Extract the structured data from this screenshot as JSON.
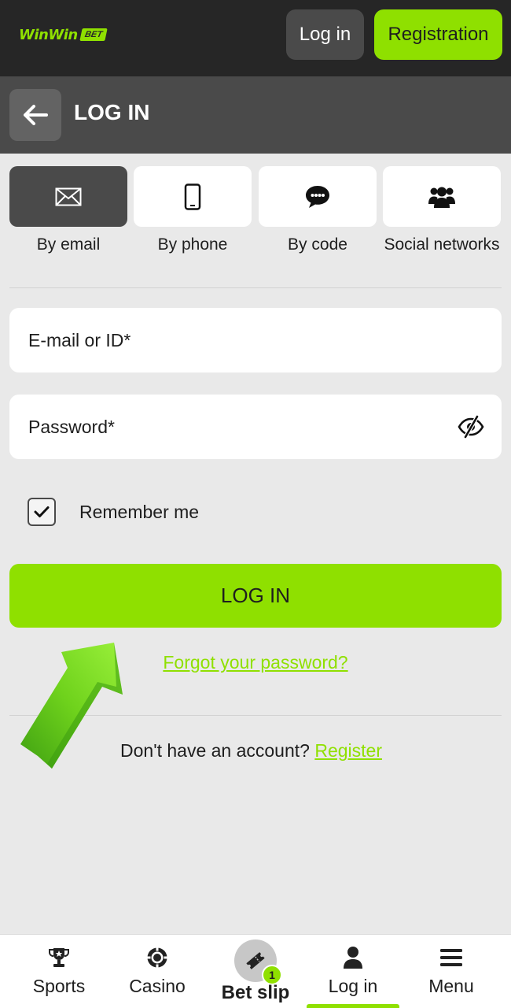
{
  "header": {
    "logo_text": "WinWin",
    "logo_badge": "BET",
    "login_label": "Log in",
    "registration_label": "Registration"
  },
  "title_bar": {
    "title": "LOG IN"
  },
  "login_methods": [
    {
      "label": "By email",
      "icon": "envelope-icon",
      "active": true
    },
    {
      "label": "By phone",
      "icon": "phone-icon",
      "active": false
    },
    {
      "label": "By code",
      "icon": "chat-bubble-icon",
      "active": false
    },
    {
      "label": "Social networks",
      "icon": "people-icon",
      "active": false
    }
  ],
  "form": {
    "email_placeholder": "E-mail or ID*",
    "email_value": "",
    "password_placeholder": "Password*",
    "password_value": "",
    "remember_label": "Remember me",
    "remember_checked": true,
    "submit_label": "LOG IN",
    "forgot_label": "Forgot your password?"
  },
  "register_prompt": {
    "text": "Don't have an account?",
    "link": "Register"
  },
  "bottom_nav": {
    "items": [
      {
        "label": "Sports",
        "icon": "trophy-icon"
      },
      {
        "label": "Casino",
        "icon": "casino-chip-icon"
      },
      {
        "label": "Bet slip",
        "icon": "ticket-icon",
        "badge": "1"
      },
      {
        "label": "Log in",
        "icon": "user-icon",
        "active": true
      },
      {
        "label": "Menu",
        "icon": "hamburger-icon"
      }
    ]
  },
  "colors": {
    "accent": "#8fe000",
    "header_bg": "#262626",
    "titlebar_bg": "#4a4a4a",
    "page_bg": "#e9e9e9"
  }
}
